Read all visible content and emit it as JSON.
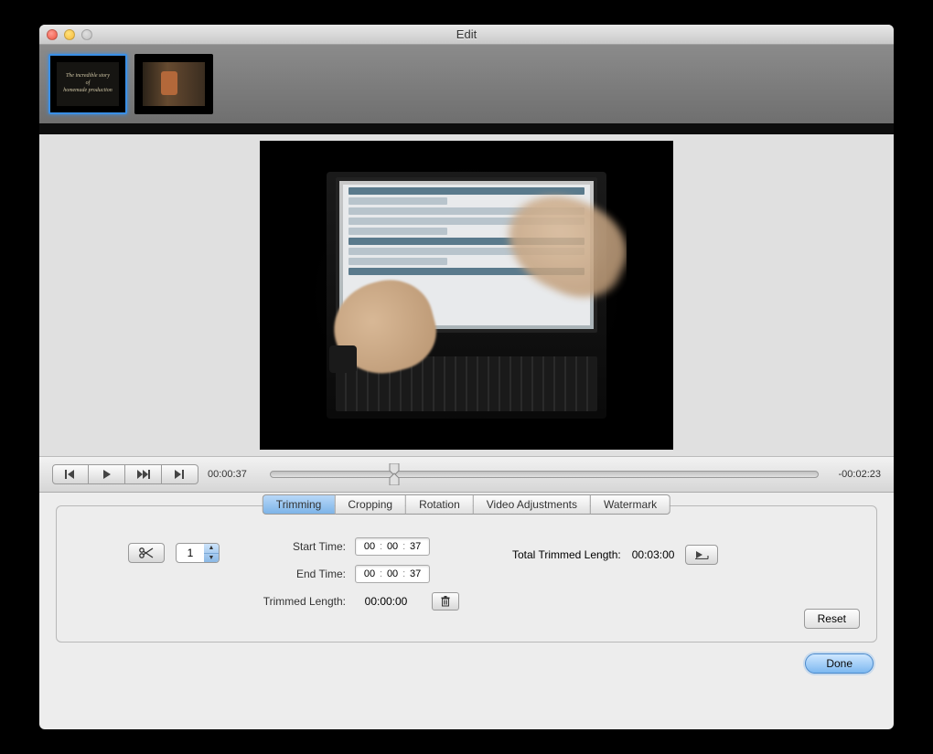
{
  "window": {
    "title": "Edit"
  },
  "playback": {
    "current_time": "00:00:37",
    "remaining_time": "-00:02:23"
  },
  "tabs": [
    "Trimming",
    "Cropping",
    "Rotation",
    "Video Adjustments",
    "Watermark"
  ],
  "active_tab": "Trimming",
  "trimming": {
    "segment_number": "1",
    "start_time_label": "Start Time:",
    "end_time_label": "End Time:",
    "trimmed_length_label": "Trimmed Length:",
    "total_trimmed_label": "Total Trimmed Length:",
    "start_time": {
      "h": "00",
      "m": "00",
      "s": "37"
    },
    "end_time": {
      "h": "00",
      "m": "00",
      "s": "37"
    },
    "trimmed_length": "00:00:00",
    "total_trimmed_length": "00:03:00"
  },
  "buttons": {
    "reset": "Reset",
    "done": "Done"
  }
}
